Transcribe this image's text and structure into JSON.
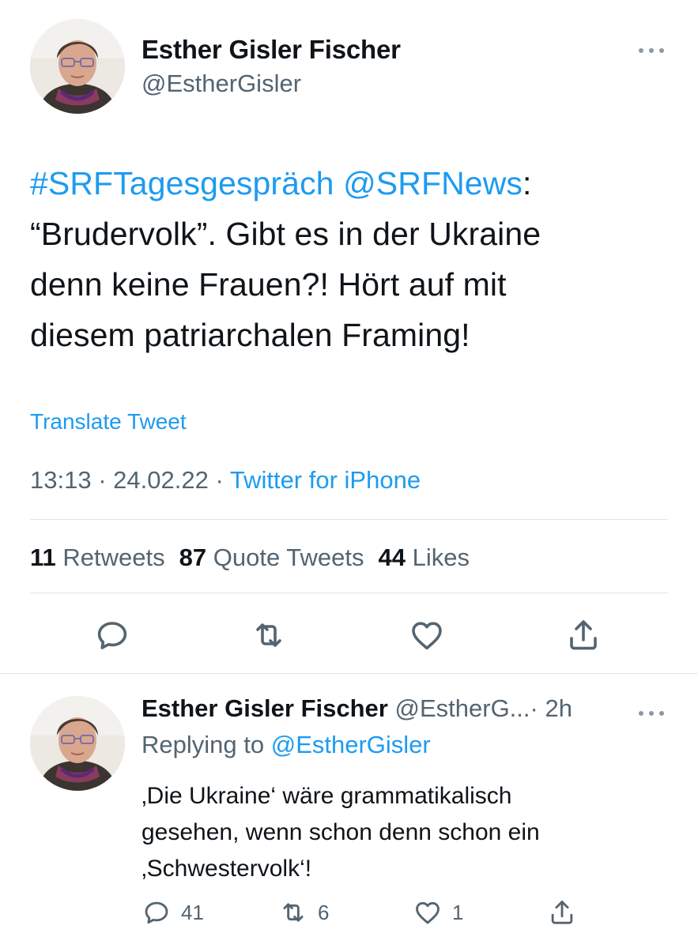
{
  "main_tweet": {
    "author_name": "Esther Gisler Fischer",
    "author_handle": "@EstherGisler",
    "hashtag": "#SRFTagesgespräch",
    "mention": "@SRFNews",
    "colon": ":",
    "body": "“Brudervolk”. Gibt es in der Ukraine\ndenn keine Frauen?! Hört auf mit\ndiesem patriarchalen Framing!",
    "translate_label": "Translate Tweet",
    "time": "13:13",
    "date": "24.02.22",
    "separator": "·",
    "source": "Twitter for iPhone",
    "stats": {
      "retweets_count": "11",
      "retweets_label": "Retweets",
      "quotes_count": "87",
      "quotes_label": "Quote Tweets",
      "likes_count": "44",
      "likes_label": "Likes"
    },
    "actions": [
      "reply-icon",
      "retweet-icon",
      "like-icon",
      "share-icon"
    ]
  },
  "reply_tweet": {
    "author_name": "Esther Gisler Fischer",
    "author_handle_truncated": "@EstherG...",
    "time_ago": "· 2h",
    "replying_prefix": "Replying to",
    "replying_to": "@EstherGisler",
    "body": "‚Die Ukraine‘ wäre grammatikalisch\ngesehen, wenn schon denn schon ein\n‚Schwestervolk‘!",
    "counts": {
      "replies": "41",
      "retweets": "6",
      "likes": "1"
    }
  },
  "colors": {
    "link": "#1d9bf0",
    "secondary_text": "#536471",
    "primary_text": "#0f1419",
    "divider": "#e1e6ea"
  }
}
